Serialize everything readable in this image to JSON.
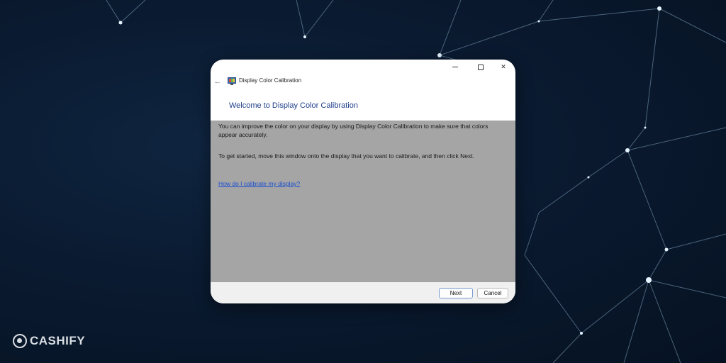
{
  "window": {
    "title": "Display Color Calibration",
    "heading": "Welcome to Display Color Calibration",
    "paragraph1": "You can improve the color on your display by using Display Color Calibration to make sure that colors appear accurately.",
    "paragraph2": "To get started, move this window onto the display that you want to calibrate, and then click Next.",
    "help_link": "How do I calibrate my display?",
    "back_glyph": "←",
    "controls": {
      "minimize_icon": "minimize-icon",
      "maximize_icon": "maximize-icon",
      "close_glyph": "✕"
    },
    "buttons": {
      "next": "Next",
      "cancel": "Cancel"
    }
  },
  "branding": {
    "name": "CASHIFY",
    "logo_icon": "cashify-logo-icon"
  },
  "colors": {
    "heading": "#1f3f8a",
    "link": "#1a4fd0",
    "content_bg": "#a5a5a5",
    "footer_bg": "#f0f0f0",
    "background_dark": "#0a1a30"
  }
}
